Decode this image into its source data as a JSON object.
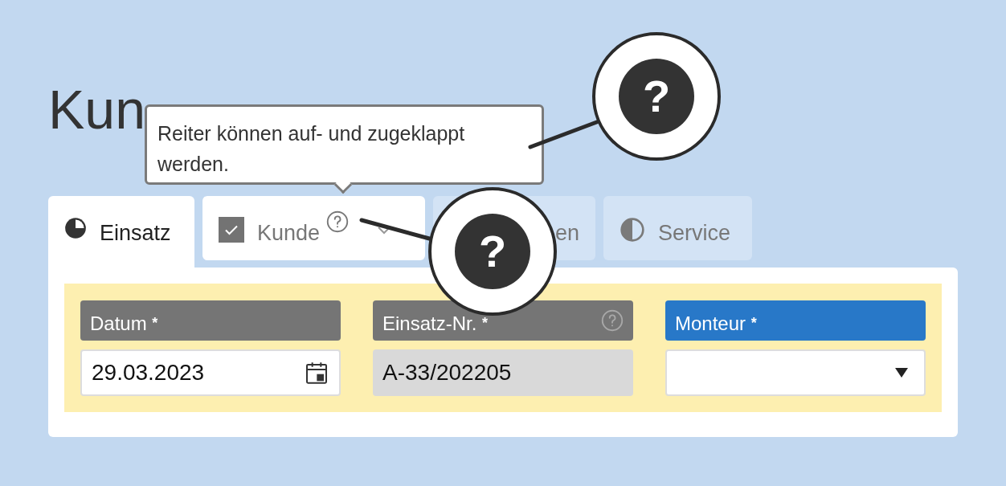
{
  "title": "Kun",
  "tabs": [
    {
      "label": "Einsatz",
      "kind": "progress",
      "selected": true,
      "disabled": false
    },
    {
      "label": "Kunde",
      "kind": "checkbox",
      "checked": true,
      "help": true,
      "expanded": true,
      "selected": false,
      "disabled": false
    },
    {
      "label": "en",
      "kind": "plain",
      "selected": false,
      "disabled": true
    },
    {
      "label": "Service",
      "kind": "half",
      "selected": false,
      "disabled": true
    }
  ],
  "fields": [
    {
      "label": "Datum",
      "required_mark": "*",
      "kind": "date",
      "value": "29.03.2023",
      "active": false,
      "help": false
    },
    {
      "label": "Einsatz-Nr.",
      "required_mark": "*",
      "kind": "readonly",
      "value": "A-33/202205",
      "active": false,
      "help": true
    },
    {
      "label": "Monteur",
      "required_mark": "*",
      "kind": "select",
      "active": true,
      "help": false
    }
  ],
  "tooltip": {
    "text": "Reiter können auf- und zugeklappt werden."
  },
  "callouts": [
    {
      "mark": "?"
    },
    {
      "mark": "?"
    }
  ]
}
